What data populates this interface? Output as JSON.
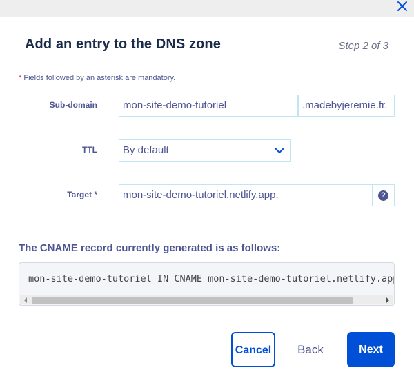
{
  "dialog": {
    "title": "Add an entry to the DNS zone",
    "step": "Step 2 of 3",
    "mandatory_note": "Fields followed by an asterisk are mandatory.",
    "mandatory_star": "*"
  },
  "form": {
    "subdomain": {
      "label": "Sub-domain",
      "value": "mon-site-demo-tutoriel",
      "suffix": ".madebyjeremie.fr."
    },
    "ttl": {
      "label": "TTL",
      "value": "By default"
    },
    "target": {
      "label": "Target *",
      "value": "mon-site-demo-tutoriel.netlify.app.",
      "help_icon": "?"
    }
  },
  "record": {
    "heading": "The CNAME record currently generated is as follows:",
    "text": "mon-site-demo-tutoriel IN CNAME mon-site-demo-tutoriel.netlify.app."
  },
  "buttons": {
    "cancel": "Cancel",
    "back": "Back",
    "next": "Next"
  },
  "colors": {
    "primary": "#0050d7",
    "text": "#4d5693",
    "title": "#1a2b4a",
    "field_border": "#bfe6f2",
    "asterisk": "#d4243b"
  },
  "icons": {
    "close": "close-icon",
    "dropdown": "chevron-down-icon",
    "help": "help-icon"
  }
}
